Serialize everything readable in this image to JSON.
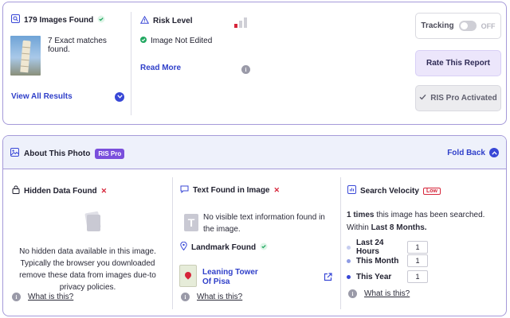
{
  "images": {
    "found_label": "179 Images Found",
    "matches_label": "7 Exact matches found.",
    "view_all": "View All Results"
  },
  "risk": {
    "title": "Risk Level",
    "status": "Image Not Edited",
    "read_more": "Read More",
    "level": "low"
  },
  "actions": {
    "tracking_label": "Tracking",
    "tracking_state": "OFF",
    "rate_label": "Rate This Report",
    "pro_label": "RIS Pro Activated"
  },
  "about": {
    "title": "About This Photo",
    "badge": "RIS Pro",
    "fold_label": "Fold Back"
  },
  "hidden_data": {
    "title": "Hidden Data Found",
    "message": "No hidden data available in this image. Typically the browser you downloaded remove these data from images due-to privacy policies.",
    "what_link": "What is this?"
  },
  "text_found": {
    "title": "Text Found in Image",
    "message": "No visible text information found in the image.",
    "landmark_title": "Landmark Found",
    "landmark_name": "Leaning Tower Of Pisa",
    "what_link": "What is this?"
  },
  "velocity": {
    "title": "Search Velocity",
    "badge": "Low",
    "count": "1",
    "sentence_mid": "times",
    "sentence_rest": "this image has been searched. Within",
    "period": "Last 8 Months.",
    "rows": [
      {
        "label": "Last 24 Hours",
        "value": "1"
      },
      {
        "label": "This Month",
        "value": "1"
      },
      {
        "label": "This Year",
        "value": "1"
      }
    ],
    "what_link": "What is this?"
  },
  "colors": {
    "accent": "#2f3fc9",
    "danger": "#d6253a",
    "success": "#22a861",
    "pro_purple": "#7a4fdc",
    "border": "#a59ad9"
  }
}
